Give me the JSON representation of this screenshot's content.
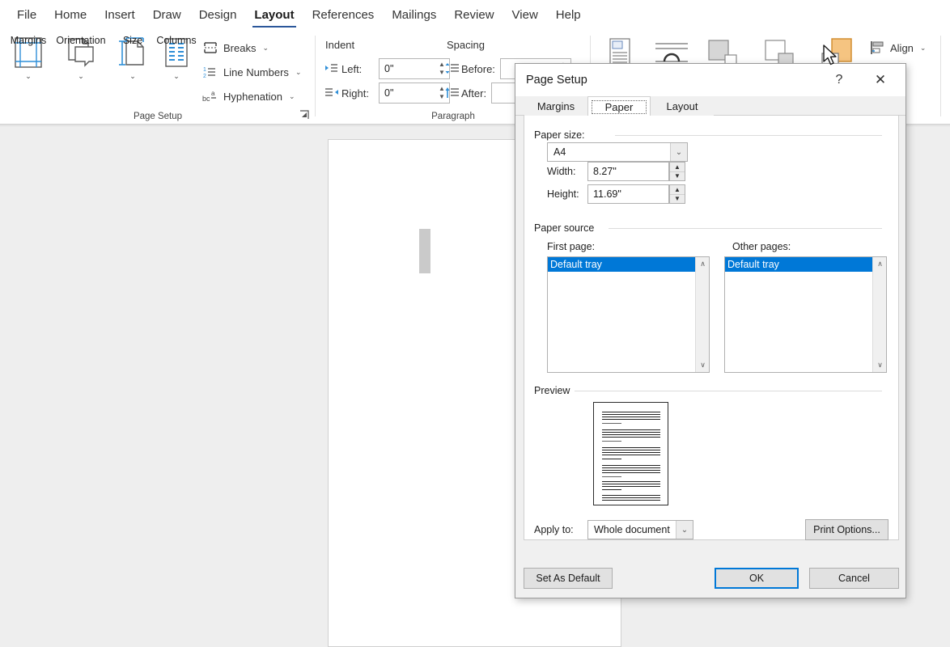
{
  "ribbon": {
    "tabs": [
      {
        "label": "File",
        "active": false
      },
      {
        "label": "Home",
        "active": false
      },
      {
        "label": "Insert",
        "active": false
      },
      {
        "label": "Draw",
        "active": false
      },
      {
        "label": "Design",
        "active": false
      },
      {
        "label": "Layout",
        "active": true
      },
      {
        "label": "References",
        "active": false
      },
      {
        "label": "Mailings",
        "active": false
      },
      {
        "label": "Review",
        "active": false
      },
      {
        "label": "View",
        "active": false
      },
      {
        "label": "Help",
        "active": false
      }
    ],
    "page_setup_group": {
      "group_label": "Page Setup",
      "big_buttons": [
        {
          "label": "Margins",
          "icon": "margins-icon",
          "caret": "⌄"
        },
        {
          "label": "Orientation",
          "icon": "orientation-icon",
          "caret": "⌄"
        },
        {
          "label": "Size",
          "icon": "size-icon",
          "caret": "⌄"
        },
        {
          "label": "Columns",
          "icon": "columns-icon",
          "caret": "⌄"
        }
      ],
      "small_buttons": [
        {
          "label": "Breaks",
          "icon": "breaks-icon",
          "caret": "⌄"
        },
        {
          "label": "Line Numbers",
          "icon": "line-numbers-icon",
          "caret": "⌄"
        },
        {
          "label": "Hyphenation",
          "icon": "hyphenation-icon",
          "caret": "⌄"
        }
      ],
      "dialog_launcher": "⤡"
    },
    "paragraph_group": {
      "group_label": "Paragraph",
      "indent_title": "Indent",
      "spacing_title": "Spacing",
      "left_label": "Left:",
      "left_value": "0\"",
      "right_label": "Right:",
      "right_value": "0\"",
      "before_label": "Before:",
      "after_label": "After:"
    },
    "arrange_group": {
      "align_label": "Align",
      "align_caret": "⌄",
      "icons": [
        "position-icon",
        "wrap-text-icon",
        "bring-forward-icon",
        "send-backward-icon",
        "selection-pane-icon"
      ]
    }
  },
  "dialog": {
    "title": "Page Setup",
    "help_icon": "?",
    "close_icon": "✕",
    "tabs": [
      {
        "label": "Margins",
        "selected": false
      },
      {
        "label": "Paper",
        "selected": true
      },
      {
        "label": "Layout",
        "selected": false
      }
    ],
    "paper_size": {
      "group_label": "Paper size:",
      "selected": "A4",
      "dropdown_icon": "⌄",
      "width_label": "Width:",
      "width_value": "8.27\"",
      "height_label": "Height:",
      "height_value": "11.69\""
    },
    "paper_source": {
      "group_label": "Paper source",
      "first_page_label": "First page:",
      "first_page_selected": "Default tray",
      "other_pages_label": "Other pages:",
      "other_pages_selected": "Default tray",
      "scroll_up_icon": "∧",
      "scroll_down_icon": "∨"
    },
    "preview": {
      "group_label": "Preview"
    },
    "apply_to": {
      "label": "Apply to:",
      "value": "Whole document",
      "dropdown_icon": "⌄"
    },
    "buttons": {
      "print_options": "Print Options...",
      "set_as_default": "Set As Default",
      "ok": "OK",
      "cancel": "Cancel"
    }
  },
  "colors": {
    "accent": "#2b579a",
    "selection": "#0078d7",
    "default_button_border": "#0078d7",
    "canvas": "#eeeeee",
    "dialog_bg": "#f0f0f0"
  }
}
